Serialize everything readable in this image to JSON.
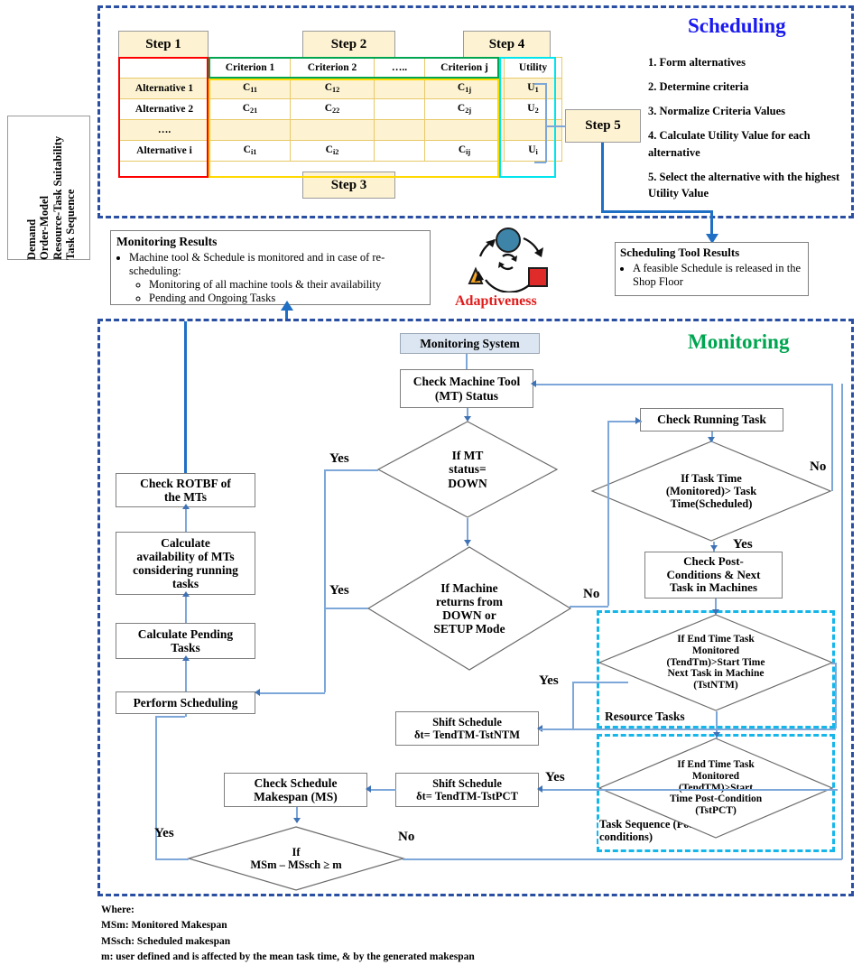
{
  "inputs_label": "Demand\nOrder-Model\nResource-Task Suitability\nTask Sequence",
  "scheduling": {
    "section_title": "Scheduling",
    "steps": {
      "step1": "Step 1",
      "step2": "Step 2",
      "step3": "Step 3",
      "step4": "Step 4",
      "step5": "Step 5"
    },
    "table": {
      "headers": [
        "",
        "Criterion 1",
        "Criterion 2",
        "…..",
        "Criterion j",
        "Utility"
      ],
      "rows": [
        [
          "Alternative 1",
          "C11",
          "C12",
          "",
          "C1j",
          "U1"
        ],
        [
          "Alternative 2",
          "C21",
          "C22",
          "",
          "C2j",
          "U2"
        ],
        [
          "….",
          "",
          "",
          "",
          "",
          ""
        ],
        [
          "Alternative i",
          "Ci1",
          "Ci2",
          "",
          "Cij",
          "Ui"
        ]
      ]
    },
    "procedure": [
      "1. Form alternatives",
      "2. Determine criteria",
      "3. Normalize Criteria Values",
      "4. Calculate Utility Value for each alternative",
      "5. Select the alternative with the highest Utility Value"
    ]
  },
  "monitoring_results": {
    "title": "Monitoring Results",
    "bullet": "Machine tool & Schedule is monitored and in case of re-scheduling:",
    "sub_bullets": [
      "Monitoring of all machine tools & their availability",
      "Pending and Ongoing Tasks"
    ]
  },
  "adaptiveness": {
    "label": "Adaptiveness"
  },
  "scheduling_tool_results": {
    "title": "Scheduling Tool Results",
    "bullet": "A feasible Schedule is released in the Shop Floor"
  },
  "monitoring": {
    "section_title": "Monitoring",
    "monitoring_system": "Monitoring System",
    "check_mt_status": "Check Machine Tool\n(MT) Status",
    "if_mt_down": "If MT\nstatus=\nDOWN",
    "if_machine_returns": "If Machine\nreturns from\nDOWN or\nSETUP Mode",
    "check_running_task": "Check Running Task",
    "if_task_time": "If Task Time\n(Monitored)> Task\nTime(Scheduled)",
    "check_post_conditions": "Check Post-\nConditions & Next\nTask in Machines",
    "resource_tasks_group": "Resource Tasks",
    "if_end_time_ntm": "If End Time Task\nMonitored\n(TendTm)>Start Time\nNext Task in Machine\n(TstNTM)",
    "task_sequence_group": "Task Sequence (Post-\nconditions)",
    "if_end_time_pct": "If End Time Task\nMonitored\n(TendTM)>Start\nTime Post-Condition\n(TstPCT)",
    "shift_schedule_ntm": "Shift Schedule\nδt= TendTM-TstNTM",
    "shift_schedule_pct": "Shift Schedule\nδt= TendTM-TstPCT",
    "check_makespan": "Check Schedule\nMakespan (MS)",
    "if_makespan": "If\nMSm – MSsch ≥ m",
    "check_rotbf": "Check ROTBF of\nthe MTs",
    "calculate_availability": "Calculate\navailability of MTs\nconsidering running\ntasks",
    "calculate_pending": "Calculate Pending\nTasks",
    "perform_scheduling": "Perform Scheduling",
    "labels": {
      "yes": "Yes",
      "no": "No"
    }
  },
  "footer": {
    "where": "Where:",
    "lines": [
      "MSm: Monitored Makespan",
      "MSsch: Scheduled makespan",
      "m: user defined and is affected by the mean task time, & by the generated makespan"
    ]
  },
  "colors": {
    "scheduling_title": "#1a1af0",
    "monitoring_title": "#00a550",
    "adaptiveness_title": "#e01b1b",
    "dashed_blue": "#2a4fa2",
    "dashed_cyan": "#15b6ea",
    "step_fill": "#fdf3d2",
    "red_outline": "#ff0000",
    "green_outline": "#00a550",
    "yellow_outline": "#ffd900",
    "cyan_outline": "#00e5ee"
  }
}
